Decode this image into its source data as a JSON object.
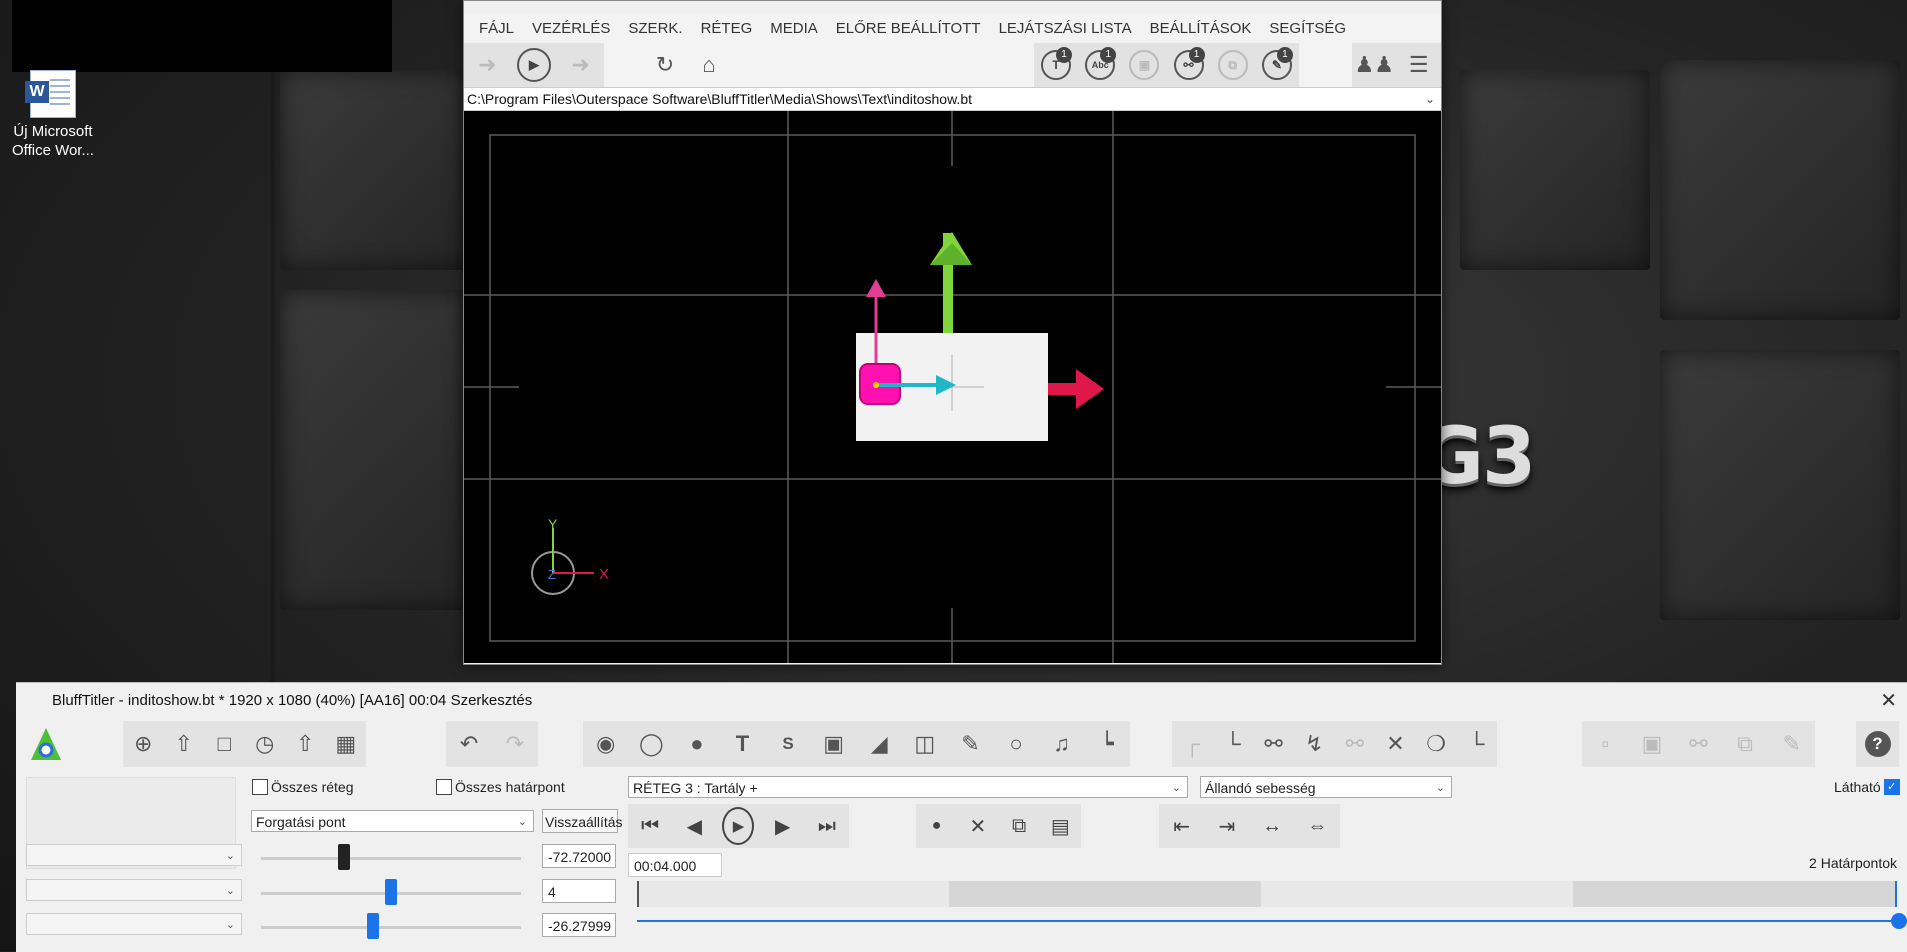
{
  "desktop": {
    "icon_label_line1": "Új Microsoft",
    "icon_label_line2": "Office Wor...",
    "logo_fragment": "G3"
  },
  "preview_window": {
    "menu": [
      "FÁJL",
      "VEZÉRLÉS",
      "SZERK.",
      "RÉTEG",
      "MEDIA",
      "ELŐRE BEÁLLÍTOTT",
      "LEJÁTSZÁSI LISTA",
      "BEÁLLÍTÁSOK",
      "SEGÍTSÉG"
    ],
    "badges": [
      "1",
      "1",
      "1",
      "1"
    ],
    "path": "C:\\Program Files\\Outerspace Software\\BluffTitler\\Media\\Shows\\Text\\inditoshow.bt",
    "axis_y": "Y",
    "axis_x": "X",
    "axis_z": "Z"
  },
  "editor": {
    "title": "BluffTitler - inditoshow.bt * 1920 x 1080 (40%) [AA16] 00:04 Szerkesztés",
    "all_layers": "Összes réteg",
    "all_keyframes": "Összes határpont",
    "property_select": "Forgatási pont",
    "reset_button": "Visszaállítás",
    "value1": "-72.72000",
    "value2": "4",
    "value3": "-26.27999",
    "layer_select": "RÉTEG 3  : Tartály +",
    "speed_select": "Állandó sebesség",
    "visible_label": "Látható",
    "time_value": "00:04.000",
    "keyframes_label": "2 Határpontok",
    "slider1_pct": 0.32,
    "slider2_pct": 0.5,
    "slider3_pct": 0.43
  },
  "colors": {
    "x_axis": "#e0174a",
    "y_axis": "#7ed63a",
    "pivot": "#e23c94",
    "local": "#1fb8c8",
    "accent": "#1a73e8"
  }
}
